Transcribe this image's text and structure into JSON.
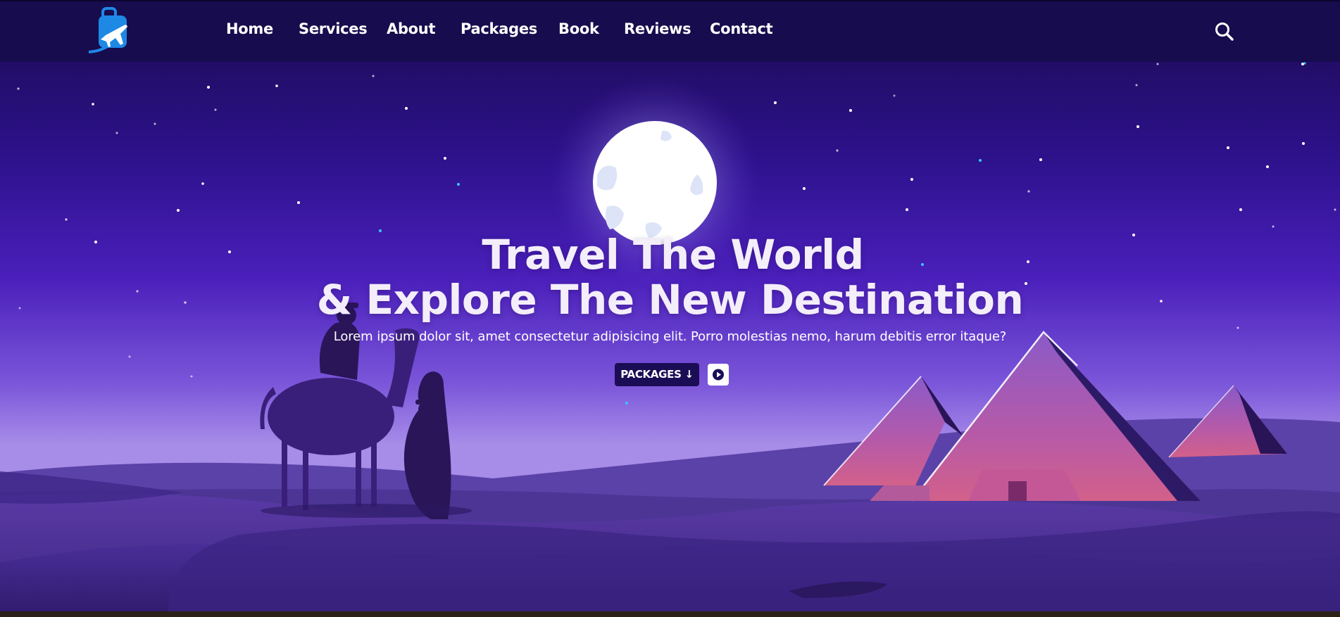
{
  "nav": {
    "logo_icon": "travel-bag-plane-logo",
    "links": [
      "Home",
      "Services",
      "About",
      "Packages",
      "Book",
      "Reviews",
      "Contact"
    ],
    "search_icon": "search-icon"
  },
  "hero": {
    "title_line1": "Travel The World",
    "title_line2": "& Explore The New Destination",
    "subtitle": "Lorem ipsum dolor sit, amet consectetur adipisicing elit. Porro molestias nemo, harum debitis error itaque?",
    "packages_button": "PACKAGES ↓",
    "play_icon": "play-circle-icon"
  },
  "colors": {
    "navbar": "#170c4d",
    "sky_top": "#1a0b4a",
    "sky_mid": "#4a1fb8",
    "horizon": "#a88be6",
    "button_dark": "#1b0d55",
    "text": "#ffffff"
  }
}
